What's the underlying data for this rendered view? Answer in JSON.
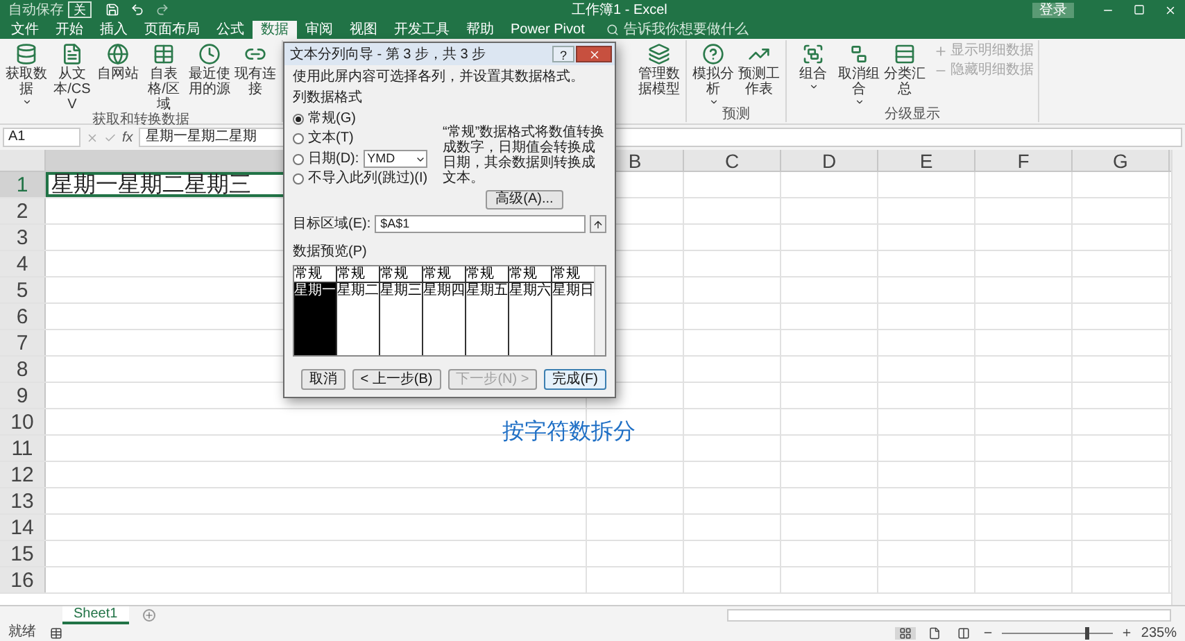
{
  "title_bar": {
    "autosave_label": "自动保存",
    "autosave_state": "关",
    "title": "工作簿1 - Excel",
    "sign_in": "登录"
  },
  "ribbon_tabs": [
    {
      "label": "文件",
      "selected": false
    },
    {
      "label": "开始",
      "selected": false
    },
    {
      "label": "插入",
      "selected": false
    },
    {
      "label": "页面布局",
      "selected": false
    },
    {
      "label": "公式",
      "selected": false
    },
    {
      "label": "数据",
      "selected": true
    },
    {
      "label": "审阅",
      "selected": false
    },
    {
      "label": "视图",
      "selected": false
    },
    {
      "label": "开发工具",
      "selected": false
    },
    {
      "label": "帮助",
      "selected": false
    },
    {
      "label": "Power Pivot",
      "selected": false
    }
  ],
  "tell_me": {
    "placeholder": "告诉我你想要做什么"
  },
  "ribbon_groups": [
    {
      "label": "获取和转换数据",
      "buttons": [
        {
          "kind": "large",
          "label": "获取数据",
          "dropdown": true,
          "disabled": false
        },
        {
          "kind": "large",
          "label": "从文本/CSV",
          "dropdown": false,
          "disabled": false
        },
        {
          "kind": "large",
          "label": "自网站",
          "dropdown": false,
          "disabled": false
        },
        {
          "kind": "large",
          "label": "自表格/区域",
          "dropdown": false,
          "disabled": false
        },
        {
          "kind": "large",
          "label": "最近使用的源",
          "dropdown": false,
          "disabled": false
        },
        {
          "kind": "large",
          "label": "现有连接",
          "dropdown": false,
          "disabled": false
        }
      ]
    },
    {
      "buttons": [
        {
          "kind": "large",
          "label": "管理数据模型",
          "dropdown": false,
          "disabled": false
        }
      ]
    },
    {
      "label": "预测",
      "buttons": [
        {
          "kind": "large",
          "label": "模拟分析",
          "dropdown": true,
          "disabled": false
        },
        {
          "kind": "large",
          "label": "预测工作表",
          "dropdown": false,
          "disabled": false
        }
      ]
    },
    {
      "label": "分级显示",
      "buttons": [
        {
          "kind": "large",
          "label": "组合",
          "dropdown": true,
          "disabled": false
        },
        {
          "kind": "large",
          "label": "取消组合",
          "dropdown": true,
          "disabled": false
        },
        {
          "kind": "large",
          "label": "分类汇总",
          "dropdown": false,
          "disabled": false
        },
        {
          "kind": "small",
          "label": "显示明细数据",
          "dropdown": false,
          "disabled": true
        },
        {
          "kind": "small",
          "label": "隐藏明细数据",
          "dropdown": false,
          "disabled": true
        }
      ]
    }
  ],
  "formula_bar": {
    "name_box": "A1",
    "fx": "fx",
    "content": "星期一星期二星期"
  },
  "columns": [
    "B",
    "C",
    "D",
    "E",
    "F",
    "G"
  ],
  "rows": [
    "1",
    "2",
    "3",
    "4",
    "5",
    "6",
    "7",
    "8",
    "9",
    "10",
    "11",
    "12",
    "13",
    "14",
    "15",
    "16"
  ],
  "cell_a1": "星期一星期二星期三",
  "caption": "按字符数拆分",
  "dialog": {
    "title": "文本分列向导 - 第 3 步，共 3 步",
    "help": "?",
    "instruction": "使用此屏内容可选择各列，并设置其数据格式。",
    "format_label": "列数据格式",
    "formats": [
      {
        "label": "常规(G)",
        "selected": true
      },
      {
        "label": "文本(T)",
        "selected": false
      },
      {
        "label": "日期(D):",
        "selected": false,
        "select_value": "YMD"
      },
      {
        "label": "不导入此列(跳过)(I)",
        "selected": false
      }
    ],
    "description": "“常规”数据格式将数值转换成数字，日期值会转换成日期，其余数据则转换成文本。",
    "advanced": "高级(A)...",
    "destination_label": "目标区域(E):",
    "destination_value": "$A$1",
    "preview_label": "数据预览(P)",
    "preview_columns": [
      {
        "header": "常规",
        "value": "星期一",
        "selected": true
      },
      {
        "header": "常规",
        "value": "星期二",
        "selected": false
      },
      {
        "header": "常规",
        "value": "星期三",
        "selected": false
      },
      {
        "header": "常规",
        "value": "星期四",
        "selected": false
      },
      {
        "header": "常规",
        "value": "星期五",
        "selected": false
      },
      {
        "header": "常规",
        "value": "星期六",
        "selected": false
      },
      {
        "header": "常规",
        "value": "星期日",
        "selected": false
      }
    ],
    "buttons": [
      {
        "label": "取消",
        "disabled": false,
        "default": false
      },
      {
        "label": "< 上一步(B)",
        "disabled": false,
        "default": false
      },
      {
        "label": "下一步(N) >",
        "disabled": true,
        "default": false
      },
      {
        "label": "完成(F)",
        "disabled": false,
        "default": true
      }
    ]
  },
  "sheet_tabs": [
    {
      "label": "Sheet1",
      "selected": true
    }
  ],
  "status_bar": {
    "status": "就绪",
    "views": [
      {
        "kind": "normal",
        "selected": true
      },
      {
        "kind": "page_layout",
        "selected": false
      },
      {
        "kind": "page_break",
        "selected": false
      }
    ],
    "zoom": {
      "level": 0.75,
      "reading": "235%"
    }
  }
}
